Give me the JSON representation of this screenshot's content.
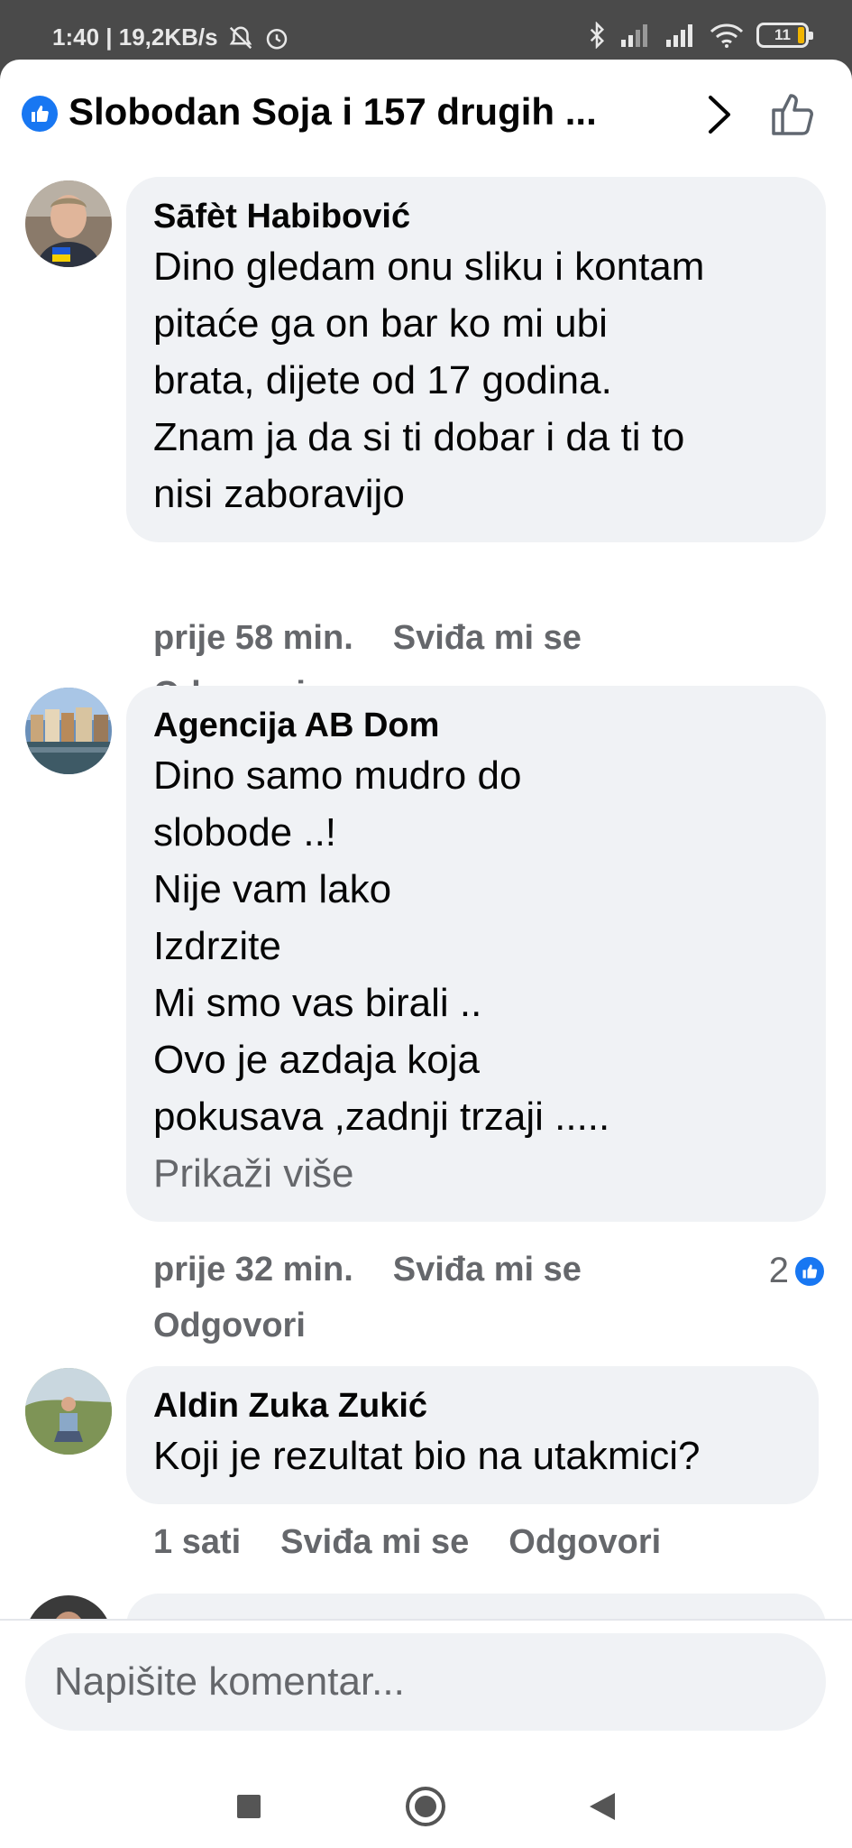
{
  "status_bar": {
    "time_speed": "1:40 | 19,2KB/s",
    "battery": "11"
  },
  "header": {
    "title": "Slobodan Soja i 157 drugih ..."
  },
  "comments": [
    {
      "author": "Sāfèt Habibović",
      "text": "Dino gledam onu sliku i kontam\npitaće ga on bar ko mi ubi\nbrata, dijete od 17 godina.\nZnam ja da si ti dobar i da ti to\nnisi zaboravijo",
      "time": "prije 58 min.",
      "like": "Sviđa mi se",
      "reply": "Odgovori"
    },
    {
      "author": "Agencija AB Dom",
      "text": "Dino samo mudro do\nslobode   ..!\nNije vam lako\nIzdrzite\nMi smo vas birali   ..\nOvo je azdaja koja\npokusava ,zadnji trzaji .....",
      "more": "Prikaži više",
      "time": "prije 32 min.",
      "like": "Sviđa mi se",
      "reply": "Odgovori",
      "reactions": "2"
    },
    {
      "author": "Aldin Zuka Zukić",
      "text": "Koji je rezultat bio na utakmici?",
      "time": "1 sati",
      "like": "Sviđa mi se",
      "reply": "Odgovori"
    }
  ],
  "composer": {
    "placeholder": "Napišite komentar..."
  },
  "colors": {
    "accent": "#1877f2",
    "bubble": "#f0f2f5",
    "muted_text": "#65676b"
  }
}
